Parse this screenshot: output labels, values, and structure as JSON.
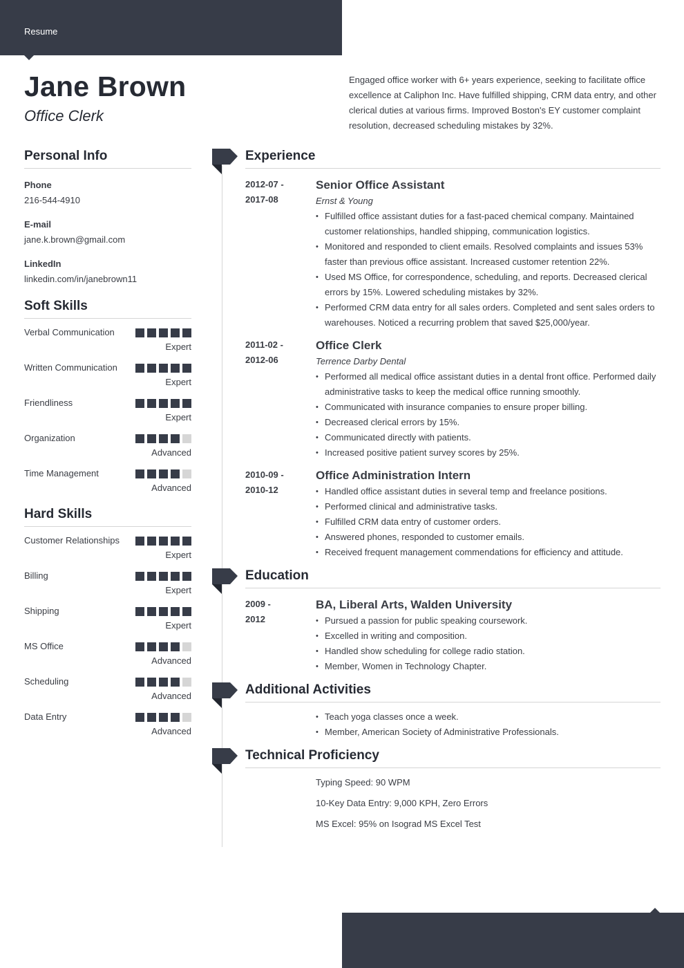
{
  "header": {
    "label": "Resume"
  },
  "profile": {
    "name": "Jane Brown",
    "title": "Office Clerk",
    "summary": "Engaged office worker with 6+ years experience, seeking to facilitate office excellence at Caliphon Inc. Have fulfilled shipping, CRM data entry, and other clerical duties at various firms. Improved Boston's EY customer complaint resolution, decreased scheduling mistakes by 32%."
  },
  "personal_info": {
    "title": "Personal Info",
    "items": [
      {
        "label": "Phone",
        "value": "216-544-4910"
      },
      {
        "label": "E-mail",
        "value": "jane.k.brown@gmail.com"
      },
      {
        "label": "LinkedIn",
        "value": "linkedin.com/in/janebrown11"
      }
    ]
  },
  "soft_skills": {
    "title": "Soft Skills",
    "items": [
      {
        "name": "Verbal Communication",
        "level": "Expert",
        "rating": 5,
        "max": 5
      },
      {
        "name": "Written Communication",
        "level": "Expert",
        "rating": 5,
        "max": 5
      },
      {
        "name": "Friendliness",
        "level": "Expert",
        "rating": 5,
        "max": 5
      },
      {
        "name": "Organization",
        "level": "Advanced",
        "rating": 4,
        "max": 5
      },
      {
        "name": "Time Management",
        "level": "Advanced",
        "rating": 4,
        "max": 5
      }
    ]
  },
  "hard_skills": {
    "title": "Hard Skills",
    "items": [
      {
        "name": "Customer Relationships",
        "level": "Expert",
        "rating": 5,
        "max": 5
      },
      {
        "name": "Billing",
        "level": "Expert",
        "rating": 5,
        "max": 5
      },
      {
        "name": "Shipping",
        "level": "Expert",
        "rating": 5,
        "max": 5
      },
      {
        "name": "MS Office",
        "level": "Advanced",
        "rating": 4,
        "max": 5
      },
      {
        "name": "Scheduling",
        "level": "Advanced",
        "rating": 4,
        "max": 5
      },
      {
        "name": "Data Entry",
        "level": "Advanced",
        "rating": 4,
        "max": 5
      }
    ]
  },
  "experience": {
    "title": "Experience",
    "entries": [
      {
        "date_start": "2012-07 -",
        "date_end": "2017-08",
        "role": "Senior Office Assistant",
        "company": "Ernst & Young",
        "bullets": [
          "Fulfilled office assistant duties for a fast-paced chemical company. Maintained customer relationships, handled shipping, communication logistics.",
          "Monitored and responded to client emails. Resolved complaints and issues 53% faster than previous office assistant. Increased customer retention 22%.",
          "Used MS Office, for correspondence, scheduling, and reports. Decreased clerical errors by 15%. Lowered scheduling mistakes by 32%.",
          "Performed CRM data entry for all sales orders. Completed and sent sales orders to warehouses. Noticed a recurring problem that saved $25,000/year."
        ]
      },
      {
        "date_start": "2011-02 -",
        "date_end": "2012-06",
        "role": "Office Clerk",
        "company": "Terrence Darby Dental",
        "bullets": [
          "Performed all medical office assistant duties in a dental front office. Performed daily administrative tasks to keep the medical office running smoothly.",
          "Communicated with insurance companies to ensure proper billing.",
          "Decreased clerical errors by 15%.",
          "Communicated directly with patients.",
          "Increased positive patient survey scores by 25%."
        ]
      },
      {
        "date_start": "2010-09 -",
        "date_end": "2010-12",
        "role": "Office Administration Intern",
        "company": "",
        "bullets": [
          "Handled office assistant duties in several temp and freelance positions.",
          "Performed clinical and administrative tasks.",
          "Fulfilled CRM data entry of customer orders.",
          "Answered phones, responded to customer emails.",
          "Received frequent management commendations for efficiency and attitude."
        ]
      }
    ]
  },
  "education": {
    "title": "Education",
    "entries": [
      {
        "date_start": "2009 -",
        "date_end": "2012",
        "degree": "BA, Liberal Arts, Walden University",
        "bullets": [
          "Pursued a passion for public speaking coursework.",
          "Excelled in writing and composition.",
          "Handled show scheduling for college radio station.",
          "Member, Women in Technology Chapter."
        ]
      }
    ]
  },
  "activities": {
    "title": "Additional Activities",
    "bullets": [
      "Teach yoga classes once a week.",
      "Member, American Society of Administrative Professionals."
    ]
  },
  "technical": {
    "title": "Technical Proficiency",
    "items": [
      "Typing Speed: 90 WPM",
      "10-Key Data Entry: 9,000 KPH, Zero Errors",
      "MS Excel: 95% on Isograd MS Excel Test"
    ]
  },
  "colors": {
    "accent": "#373c48",
    "rule": "#d5d5d5",
    "skill_off": "#d6d6d6",
    "text": "#3a3d44"
  }
}
